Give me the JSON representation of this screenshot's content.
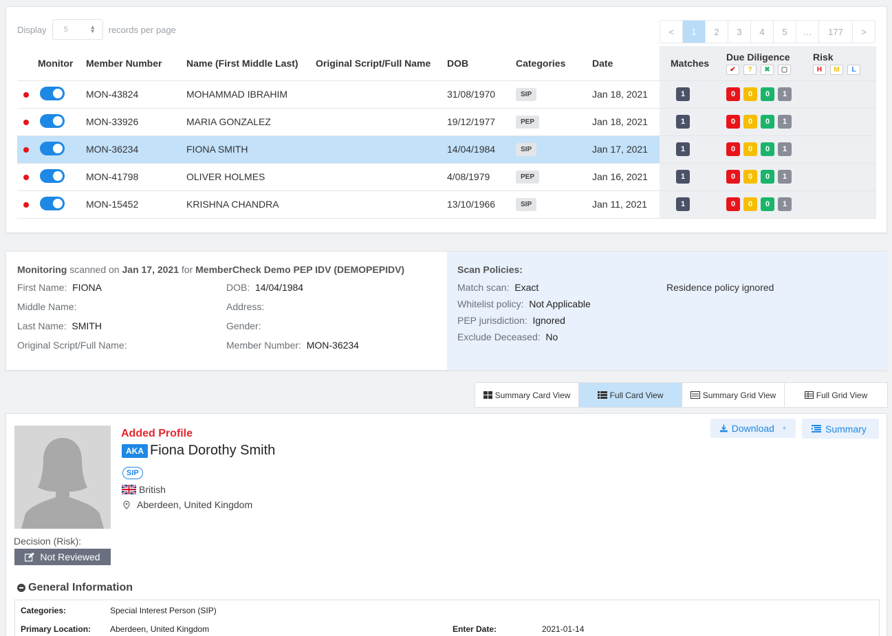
{
  "display": {
    "label": "Display",
    "value": "5",
    "suffix": "records per page"
  },
  "pagination": {
    "prev": "<",
    "pages": [
      "1",
      "2",
      "3",
      "4",
      "5",
      "…",
      "177"
    ],
    "next": ">",
    "current": "1"
  },
  "table": {
    "headers": {
      "monitor": "Monitor",
      "member_number": "Member Number",
      "name": "Name (First Middle Last)",
      "original_script": "Original Script/Full Name",
      "dob": "DOB",
      "categories": "Categories",
      "date": "Date",
      "matches": "Matches",
      "due_diligence": "Due Diligence",
      "risk": "Risk",
      "dd_icons": [
        "✔",
        "?",
        "✖",
        "▢"
      ],
      "risk_levels": [
        "H",
        "M",
        "L"
      ]
    },
    "rows": [
      {
        "member_number": "MON-43824",
        "name": "MOHAMMAD IBRAHIM",
        "original": "",
        "dob": "31/08/1970",
        "category": "SIP",
        "date": "Jan 18, 2021",
        "matches": "1",
        "dd": [
          "0",
          "0",
          "0",
          "1"
        ]
      },
      {
        "member_number": "MON-33926",
        "name": "MARIA GONZALEZ",
        "original": "",
        "dob": "19/12/1977",
        "category": "PEP",
        "date": "Jan 18, 2021",
        "matches": "1",
        "dd": [
          "0",
          "0",
          "0",
          "1"
        ]
      },
      {
        "member_number": "MON-36234",
        "name": "FIONA SMITH",
        "original": "",
        "dob": "14/04/1984",
        "category": "SIP",
        "date": "Jan 17, 2021",
        "matches": "1",
        "dd": [
          "0",
          "0",
          "0",
          "1"
        ]
      },
      {
        "member_number": "MON-41798",
        "name": "OLIVER HOLMES",
        "original": "",
        "dob": "4/08/1979",
        "category": "PEP",
        "date": "Jan 16, 2021",
        "matches": "1",
        "dd": [
          "0",
          "0",
          "0",
          "1"
        ]
      },
      {
        "member_number": "MON-15452",
        "name": "KRISHNA CHANDRA",
        "original": "",
        "dob": "13/10/1966",
        "category": "SIP",
        "date": "Jan 11, 2021",
        "matches": "1",
        "dd": [
          "0",
          "0",
          "0",
          "1"
        ]
      }
    ]
  },
  "scan": {
    "monitoring": "Monitoring",
    "scanned_on": "scanned on",
    "date": "Jan 17, 2021",
    "for": "for",
    "org": "MemberCheck Demo PEP IDV (DEMOPEPIDV)",
    "first_name_label": "First Name:",
    "first_name": "FIONA",
    "middle_name_label": "Middle Name:",
    "last_name_label": "Last Name:",
    "last_name": "SMITH",
    "original_label": "Original Script/Full Name:",
    "dob_label": "DOB:",
    "dob": "14/04/1984",
    "address_label": "Address:",
    "gender_label": "Gender:",
    "member_number_label": "Member Number:",
    "member_number": "MON-36234"
  },
  "policies": {
    "title": "Scan Policies:",
    "match_scan_label": "Match scan:",
    "match_scan": "Exact",
    "residence": "Residence policy ignored",
    "whitelist_label": "Whitelist policy:",
    "whitelist": "Not Applicable",
    "pep_label": "PEP jurisdiction:",
    "pep": "Ignored",
    "deceased_label": "Exclude Deceased:",
    "deceased": "No"
  },
  "views": [
    "Summary Card View",
    "Full Card View",
    "Summary Grid View",
    "Full Grid View"
  ],
  "profile": {
    "status": "Added Profile",
    "aka": "AKA",
    "name": "Fiona Dorothy Smith",
    "category": "SIP",
    "nationality": "British",
    "location": "Aberdeen, United Kingdom",
    "download": "Download",
    "summary": "Summary",
    "decision_label": "Decision (Risk):",
    "decision": "Not Reviewed"
  },
  "general": {
    "title": "General Information",
    "categories_label": "Categories:",
    "categories": "Special Interest Person (SIP)",
    "location_label": "Primary Location:",
    "location": "Aberdeen, United Kingdom",
    "enter_label": "Enter Date:",
    "enter": "2021-01-14"
  },
  "colors": {
    "accent": "#1e88e5",
    "selected_row": "#c3e1f9",
    "red": "#e8141a",
    "yellow": "#f6be00",
    "green": "#1ab56b",
    "gray": "#888d97",
    "navy": "#4b5167"
  }
}
